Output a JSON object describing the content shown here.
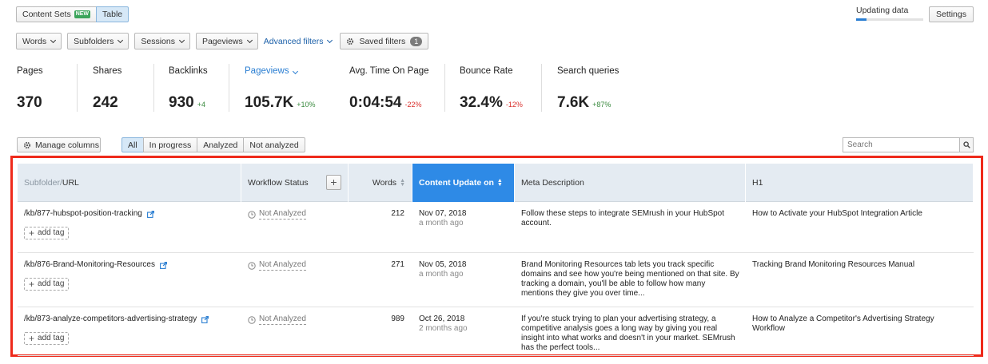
{
  "view_toggle": {
    "content_sets": "Content Sets",
    "new_badge": "NEW",
    "table": "Table"
  },
  "updating": {
    "label": "Updating data",
    "progress": 0.15
  },
  "settings_label": "Settings",
  "filters": {
    "words": "Words",
    "subfolders": "Subfolders",
    "sessions": "Sessions",
    "pageviews": "Pageviews",
    "advanced": "Advanced filters",
    "saved": "Saved filters",
    "saved_count": "1"
  },
  "metrics": [
    {
      "label": "Pages",
      "value": "370",
      "delta": ""
    },
    {
      "label": "Shares",
      "value": "242",
      "delta": ""
    },
    {
      "label": "Backlinks",
      "value": "930",
      "delta": "+4"
    },
    {
      "label": "Pageviews",
      "value": "105.7K",
      "delta": "+10%"
    },
    {
      "label": "Avg. Time On Page",
      "value": "0:04:54",
      "delta": "-22%"
    },
    {
      "label": "Bounce Rate",
      "value": "32.4%",
      "delta": "-12%"
    },
    {
      "label": "Search queries",
      "value": "7.6K",
      "delta": "+87%"
    }
  ],
  "toolbar": {
    "manage_columns": "Manage columns",
    "tabs": [
      "All",
      "In progress",
      "Analyzed",
      "Not analyzed"
    ],
    "search_placeholder": "Search"
  },
  "table": {
    "headers": {
      "subfolder": "Subfolder/",
      "url": "URL",
      "workflow": "Workflow Status",
      "words": "Words",
      "content_update": "Content Update on",
      "meta": "Meta Description",
      "h1": "H1"
    },
    "add_tag": "add tag",
    "rows": [
      {
        "url": "/kb/877-hubspot-position-tracking",
        "status": "Not Analyzed",
        "words": "212",
        "date": "Nov 07, 2018",
        "ago": "a month ago",
        "meta": "Follow these steps to integrate SEMrush in your HubSpot account.",
        "h1": "How to Activate your HubSpot Integration Article"
      },
      {
        "url": "/kb/876-Brand-Monitoring-Resources",
        "status": "Not Analyzed",
        "words": "271",
        "date": "Nov 05, 2018",
        "ago": "a month ago",
        "meta": "Brand Monitoring Resources tab lets you track specific domains and see how you're being mentioned on that site. By tracking a domain, you'll be able to follow how many mentions they give you over time...",
        "h1": "Tracking Brand Monitoring Resources Manual"
      },
      {
        "url": "/kb/873-analyze-competitors-advertising-strategy",
        "status": "Not Analyzed",
        "words": "989",
        "date": "Oct 26, 2018",
        "ago": "2 months ago",
        "meta": "If you're stuck trying to plan your advertising strategy, a competitive analysis goes a long way by giving you real insight into what works and doesn't in your market. SEMrush has the perfect tools...",
        "h1": "How to Analyze a Competitor's Advertising Strategy Workflow"
      }
    ]
  },
  "colors": {
    "accent": "#2e8ae6",
    "highlight_frame": "#ee2a1b",
    "positive": "#3a8a3f",
    "negative": "#d9302c"
  }
}
